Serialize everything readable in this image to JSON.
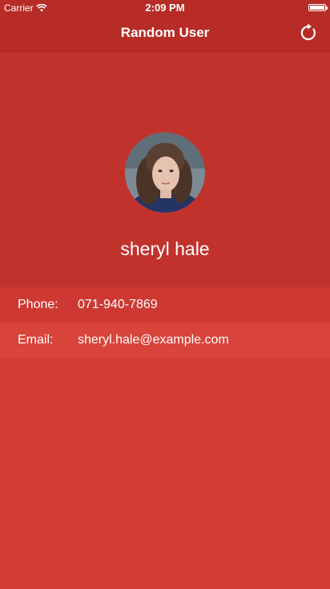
{
  "status_bar": {
    "carrier": "Carrier",
    "time": "2:09 PM"
  },
  "nav": {
    "title": "Random User",
    "refresh_icon": "refresh-icon"
  },
  "profile": {
    "name": "sheryl hale"
  },
  "contact": {
    "phone_label": "Phone:",
    "phone_value": "071-940-7869",
    "email_label": "Email:",
    "email_value": "sheryl.hale@example.com"
  },
  "colors": {
    "header": "#b72c27",
    "profile_bg": "#c1322c",
    "phone_row": "#cd3932",
    "email_row": "#d8433a",
    "screen_bg": "#d33d34"
  }
}
